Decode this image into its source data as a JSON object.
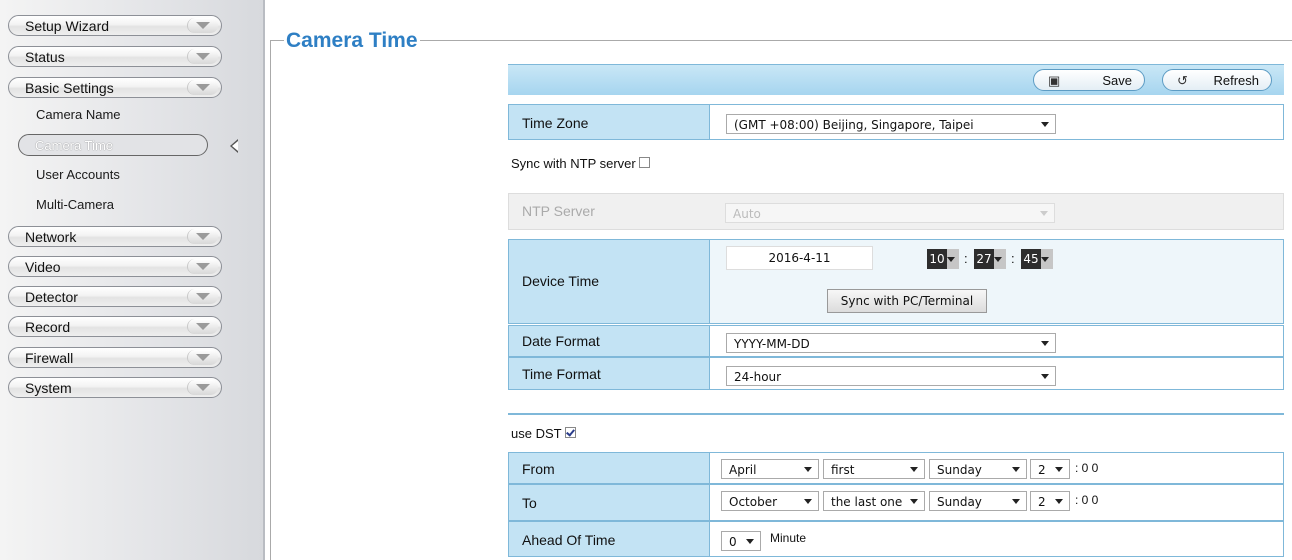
{
  "sidebar": {
    "top_items": [
      "Setup Wizard",
      "Status",
      "Basic Settings"
    ],
    "sub_items": [
      "Camera Name",
      "Camera Time",
      "User Accounts",
      "Multi-Camera"
    ],
    "bottom_items": [
      "Network",
      "Video",
      "Detector",
      "Record",
      "Firewall",
      "System"
    ]
  },
  "page": {
    "title": "Camera Time"
  },
  "toolbar": {
    "save": "Save",
    "refresh": "Refresh",
    "save_icon": "save-icon",
    "refresh_icon": "refresh-icon"
  },
  "time_zone": {
    "label": "Time Zone",
    "value": "(GMT +08:00) Beijing, Singapore, Taipei"
  },
  "ntp": {
    "sync_label": "Sync with NTP server",
    "sync_checked": false,
    "server_label": "NTP Server",
    "server_value": "Auto"
  },
  "device_time": {
    "label": "Device Time",
    "date": "2016-4-11",
    "hour": "10",
    "minute": "27",
    "second": "45",
    "sync_button": "Sync with PC/Terminal"
  },
  "date_format": {
    "label": "Date Format",
    "value": "YYYY-MM-DD"
  },
  "time_format": {
    "label": "Time Format",
    "value": "24-hour"
  },
  "dst": {
    "label": "use DST",
    "checked": true,
    "from": {
      "label": "From",
      "month": "April",
      "week": "first",
      "day": "Sunday",
      "hour": "2",
      "suffix": ": 0 0"
    },
    "to": {
      "label": "To",
      "month": "October",
      "week": "the last one",
      "day": "Sunday",
      "hour": "2",
      "suffix": ": 0 0"
    },
    "ahead": {
      "label": "Ahead Of Time",
      "value": "0",
      "unit": "Minute"
    }
  },
  "colors": {
    "accent": "#2e7fc4",
    "label_bg": "#c3e3f4",
    "border": "#7fb8d9"
  }
}
